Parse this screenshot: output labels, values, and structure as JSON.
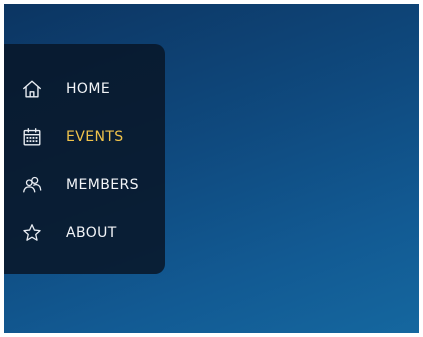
{
  "nav": {
    "items": [
      {
        "id": "home",
        "label": "HOME",
        "icon": "home-icon",
        "active": false
      },
      {
        "id": "events",
        "label": "EVENTS",
        "icon": "calendar-icon",
        "active": true
      },
      {
        "id": "members",
        "label": "MEMBERS",
        "icon": "users-icon",
        "active": false
      },
      {
        "id": "about",
        "label": "ABOUT",
        "icon": "star-icon",
        "active": false
      }
    ]
  },
  "colors": {
    "active": "#f0c34b",
    "text": "#f2f4f7",
    "panel": "#081628",
    "background": "#0f4a7f"
  }
}
